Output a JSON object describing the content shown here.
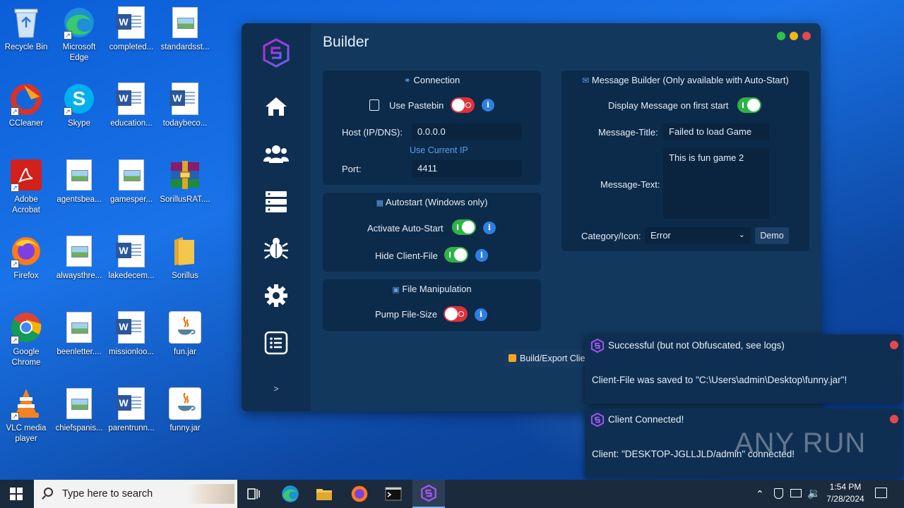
{
  "desktop": {
    "icons": [
      {
        "label": "Recycle Bin"
      },
      {
        "label": "Microsoft Edge"
      },
      {
        "label": "completed..."
      },
      {
        "label": "standardsst..."
      },
      {
        "label": "CCleaner"
      },
      {
        "label": "Skype"
      },
      {
        "label": "education..."
      },
      {
        "label": "todaybeco..."
      },
      {
        "label": "Adobe Acrobat"
      },
      {
        "label": "agentsbea..."
      },
      {
        "label": "gamesper..."
      },
      {
        "label": "SorillusRAT...."
      },
      {
        "label": "Firefox"
      },
      {
        "label": "alwaysthre..."
      },
      {
        "label": "lakedecem..."
      },
      {
        "label": "Sorillus"
      },
      {
        "label": "Google Chrome"
      },
      {
        "label": "beenletter...."
      },
      {
        "label": "missionloo..."
      },
      {
        "label": "fun.jar"
      },
      {
        "label": "VLC media player"
      },
      {
        "label": "chiefspanis..."
      },
      {
        "label": "parentrunn..."
      },
      {
        "label": "funny.jar"
      }
    ]
  },
  "app": {
    "title": "Builder",
    "sidebar_expand": ">",
    "connection": {
      "title": "Connection",
      "use_pastebin_label": "Use Pastebin",
      "use_pastebin_on": false,
      "host_label": "Host (IP/DNS):",
      "host_value": "0.0.0.0",
      "use_current_ip": "Use Current IP",
      "port_label": "Port:",
      "port_value": "4411"
    },
    "autostart": {
      "title": "Autostart (Windows only)",
      "activate_label": "Activate Auto-Start",
      "activate_on": true,
      "hide_label": "Hide Client-File",
      "hide_on": true
    },
    "file_manipulation": {
      "title": "File Manipulation",
      "pump_label": "Pump File-Size",
      "pump_on": false
    },
    "message_builder": {
      "title": "Message Builder (Only available with Auto-Start)",
      "display_label": "Display Message on first start",
      "display_on": true,
      "message_title_label": "Message-Title:",
      "message_title_value": "Failed to load Game",
      "message_text_label": "Message-Text:",
      "message_text_value": "This is fun game 2",
      "category_label": "Category/Icon:",
      "category_value": "Error",
      "demo_button": "Demo"
    },
    "build_button": "Build/Export Client-File"
  },
  "notifications": [
    {
      "title": "Successful (but not Obfuscated, see logs)",
      "body": "Client-File was saved to \"C:\\Users\\admin\\Desktop\\funny.jar\"!"
    },
    {
      "title": "Client Connected!",
      "body": "Client: \"DESKTOP-JGLLJLD/admin\" connected!"
    }
  ],
  "watermark": "ANY RUN",
  "taskbar": {
    "search_placeholder": "Type here to search",
    "time": "1:54 PM",
    "date": "7/28/2024"
  },
  "colors": {
    "accent": "#2fb347",
    "toggle_off": "#e0303a",
    "info": "#2f7fe0",
    "brand": "#8b5cf6"
  }
}
